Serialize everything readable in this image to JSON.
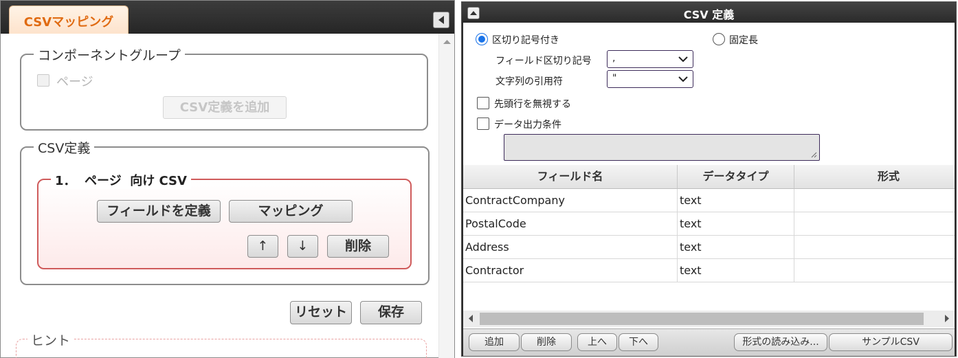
{
  "left": {
    "tab_label": "CSVマッピング",
    "components_group": {
      "legend": "コンポーネントグループ",
      "page_checkbox_label": "ページ",
      "add_csv_button": "CSV定義を追加"
    },
    "csv_group": {
      "legend": "CSV定義",
      "item_title": "1．  ページ  向け CSV",
      "define_fields_button": "フィールドを定義",
      "mapping_button": "マッピング",
      "up_button": "↑",
      "down_button": "↓",
      "delete_button": "削除"
    },
    "reset_button": "リセット",
    "save_button": "保存",
    "hint_legend": "ヒント"
  },
  "right": {
    "title": "CSV 定義",
    "delimited_label": "区切り記号付き",
    "fixed_length_label": "固定長",
    "delimited_selected": true,
    "field_delimiter_label": "フィールド区切り記号",
    "field_delimiter_value": ",",
    "quote_label": "文字列の引用符",
    "quote_value": "\"",
    "ignore_header_label": "先頭行を無視する",
    "data_output_condition_label": "データ出力条件",
    "table": {
      "headers": [
        "フィールド名",
        "データタイプ",
        "形式"
      ],
      "rows": [
        [
          "ContractCompany",
          "text",
          ""
        ],
        [
          "PostalCode",
          "text",
          ""
        ],
        [
          "Address",
          "text",
          ""
        ],
        [
          "Contractor",
          "text",
          ""
        ]
      ]
    },
    "buttons": {
      "add": "追加",
      "delete": "削除",
      "up": "上へ",
      "down": "下へ",
      "load_format": "形式の読み込み...",
      "sample_csv": "サンプルCSV"
    }
  },
  "colors": {
    "tab_text": "#e06b12",
    "radio_accent": "#1a73e8",
    "item_border": "#cf5b5b"
  }
}
